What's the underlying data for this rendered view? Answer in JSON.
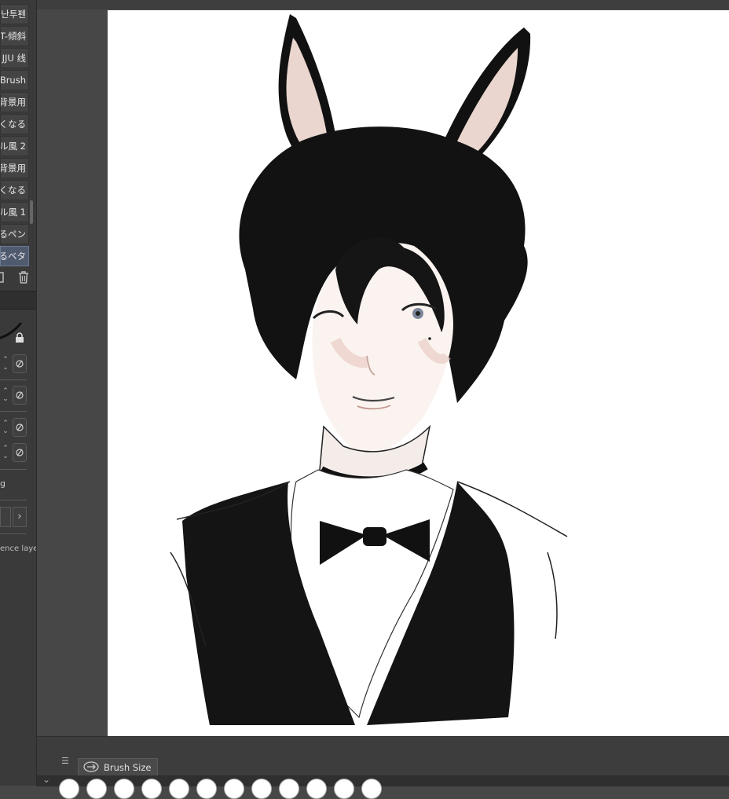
{
  "sub_tool_list": {
    "items": [
      {
        "label": "난투펜",
        "selected": false
      },
      {
        "label": "T-傾斜",
        "selected": false
      },
      {
        "label": "JJU 线",
        "selected": false
      },
      {
        "label": "Brush",
        "selected": false
      },
      {
        "label": "背景用",
        "selected": false
      },
      {
        "label": "くなる",
        "selected": false
      },
      {
        "label": "ル風 2",
        "selected": false
      },
      {
        "label": "背景用",
        "selected": false
      },
      {
        "label": "くなる",
        "selected": false
      },
      {
        "label": "ル風 1",
        "selected": false
      },
      {
        "label": "るペン",
        "selected": false
      },
      {
        "label": "るベタ",
        "selected": true
      }
    ]
  },
  "tool_property": {
    "g_label": "g",
    "reference_layer_label": "ence laye"
  },
  "bottom_palette": {
    "tab_label": "Brush Size",
    "size_presets_count": 12
  },
  "colors": {
    "background": "#474747",
    "panel": "#3a3a3a",
    "canvas": "#ffffff",
    "selected_item": "#4f5a6e"
  }
}
